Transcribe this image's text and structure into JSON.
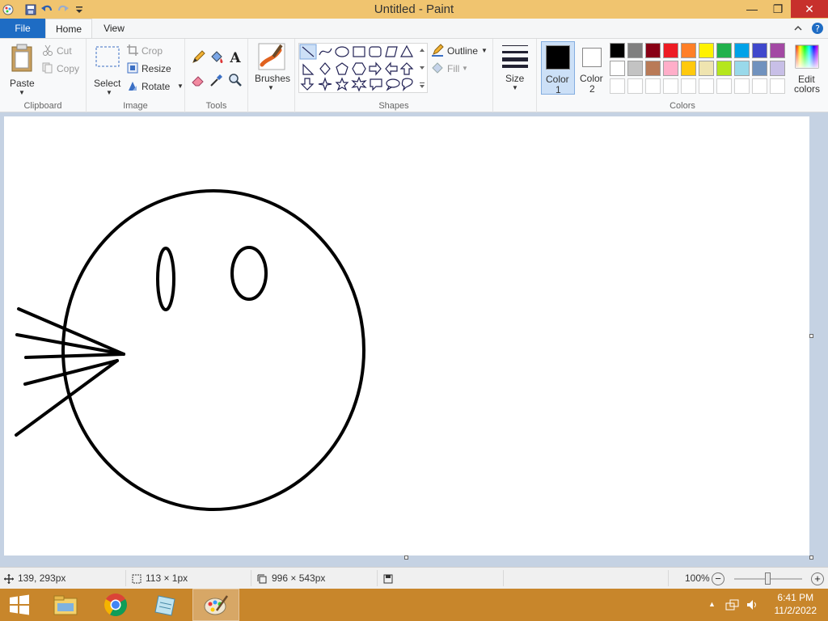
{
  "window": {
    "title": "Untitled - Paint"
  },
  "window_controls": {
    "minimize": "—",
    "maximize": "❐",
    "close": "✕"
  },
  "tabs": {
    "file": "File",
    "home": "Home",
    "view": "View"
  },
  "ribbon": {
    "clipboard": {
      "label": "Clipboard",
      "paste": "Paste",
      "cut": "Cut",
      "copy": "Copy"
    },
    "image": {
      "label": "Image",
      "select": "Select",
      "crop": "Crop",
      "resize": "Resize",
      "rotate": "Rotate"
    },
    "tools": {
      "label": "Tools"
    },
    "brushes": {
      "label": "Brushes"
    },
    "shapes": {
      "label": "Shapes",
      "outline": "Outline",
      "fill": "Fill"
    },
    "size": {
      "label": "Size"
    },
    "colors": {
      "label": "Colors",
      "color1": "Color",
      "color1_num": "1",
      "color2": "Color",
      "color2_num": "2",
      "edit": "Edit",
      "edit2": "colors",
      "color1_value": "#000000",
      "color2_value": "#ffffff",
      "palette_row1": [
        "#000000",
        "#7f7f7f",
        "#880015",
        "#ed1c24",
        "#ff7f27",
        "#fff200",
        "#22b14c",
        "#00a2e8",
        "#3f48cc",
        "#a349a4"
      ],
      "palette_row2": [
        "#ffffff",
        "#c3c3c3",
        "#b97a57",
        "#ffaec9",
        "#ffc90e",
        "#efe4b0",
        "#b5e61d",
        "#99d9ea",
        "#7092be",
        "#c8bfe7"
      ],
      "palette_row3": [
        "#ffffff",
        "#ffffff",
        "#ffffff",
        "#ffffff",
        "#ffffff",
        "#ffffff",
        "#ffffff",
        "#ffffff",
        "#ffffff",
        "#ffffff"
      ]
    }
  },
  "status": {
    "cursor": "139, 293px",
    "selection": "113 × 1px",
    "canvas_size": "996 × 543px",
    "zoom": "100%",
    "zoom_out": "−",
    "zoom_in": "+"
  },
  "taskbar": {
    "time": "6:41 PM",
    "date": "11/2/2022"
  }
}
